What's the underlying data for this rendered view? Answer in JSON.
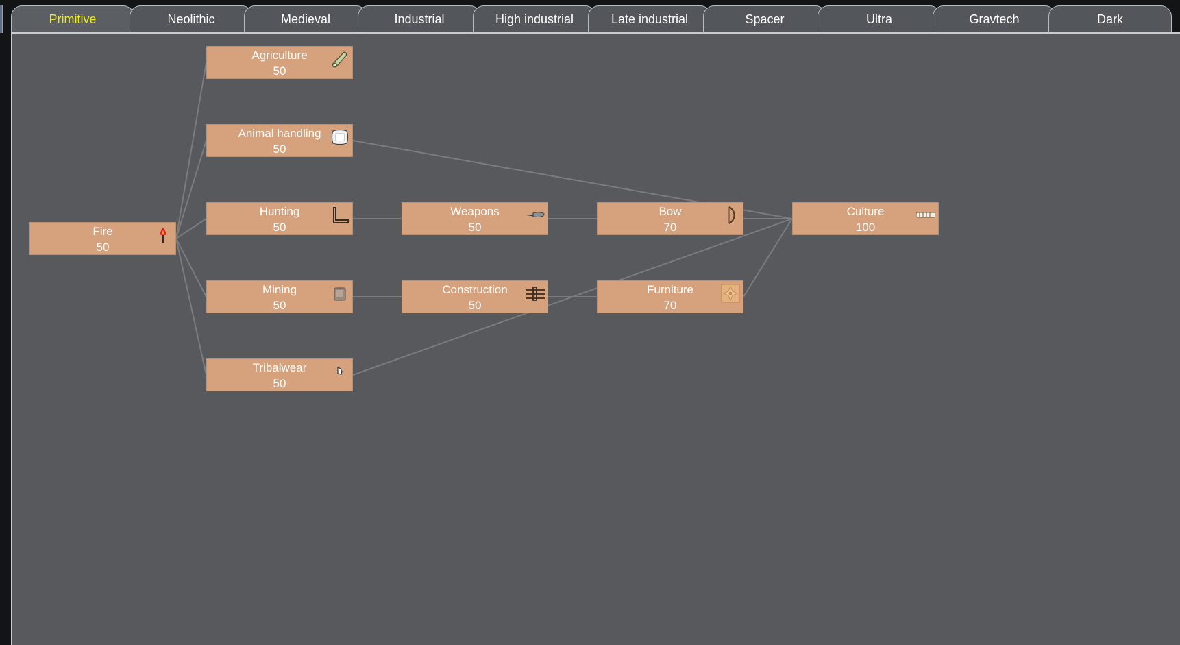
{
  "tabs": [
    {
      "id": "primitive",
      "label": "Primitive",
      "active": true
    },
    {
      "id": "neolithic",
      "label": "Neolithic",
      "active": false
    },
    {
      "id": "medieval",
      "label": "Medieval",
      "active": false
    },
    {
      "id": "industrial",
      "label": "Industrial",
      "active": false
    },
    {
      "id": "high-industrial",
      "label": "High industrial",
      "active": false
    },
    {
      "id": "late-industrial",
      "label": "Late industrial",
      "active": false
    },
    {
      "id": "spacer",
      "label": "Spacer",
      "active": false
    },
    {
      "id": "ultra",
      "label": "Ultra",
      "active": false
    },
    {
      "id": "gravtech",
      "label": "Gravtech",
      "active": false
    },
    {
      "id": "dark",
      "label": "Dark",
      "active": false
    }
  ],
  "colors": {
    "active_tab_text": "#f0ea20",
    "node_fill": "#d6a27d",
    "canvas_bg": "#58595c",
    "connector": "#7b7c7f"
  },
  "nodes": [
    {
      "id": "fire",
      "label": "Fire",
      "cost": "50",
      "icon": "torch-icon"
    },
    {
      "id": "agriculture",
      "label": "Agriculture",
      "cost": "50",
      "icon": "log-icon"
    },
    {
      "id": "animal-handling",
      "label": "Animal handling",
      "cost": "50",
      "icon": "fabric-icon"
    },
    {
      "id": "hunting",
      "label": "Hunting",
      "cost": "50",
      "icon": "frame-icon"
    },
    {
      "id": "mining",
      "label": "Mining",
      "cost": "50",
      "icon": "ore-icon"
    },
    {
      "id": "tribalwear",
      "label": "Tribalwear",
      "cost": "50",
      "icon": "shirt-icon"
    },
    {
      "id": "weapons",
      "label": "Weapons",
      "cost": "50",
      "icon": "club-icon"
    },
    {
      "id": "construction",
      "label": "Construction",
      "cost": "50",
      "icon": "wall-icon"
    },
    {
      "id": "bow",
      "label": "Bow",
      "cost": "70",
      "icon": "bow-icon"
    },
    {
      "id": "furniture",
      "label": "Furniture",
      "cost": "70",
      "icon": "rug-icon"
    },
    {
      "id": "culture",
      "label": "Culture",
      "cost": "100",
      "icon": "skeleton-icon"
    }
  ],
  "links": [
    [
      "fire",
      "agriculture"
    ],
    [
      "fire",
      "animal-handling"
    ],
    [
      "fire",
      "hunting"
    ],
    [
      "fire",
      "mining"
    ],
    [
      "fire",
      "tribalwear"
    ],
    [
      "hunting",
      "weapons"
    ],
    [
      "mining",
      "construction"
    ],
    [
      "weapons",
      "bow"
    ],
    [
      "construction",
      "furniture"
    ],
    [
      "animal-handling",
      "culture"
    ],
    [
      "bow",
      "culture"
    ],
    [
      "tribalwear",
      "culture"
    ],
    [
      "furniture",
      "culture"
    ]
  ]
}
